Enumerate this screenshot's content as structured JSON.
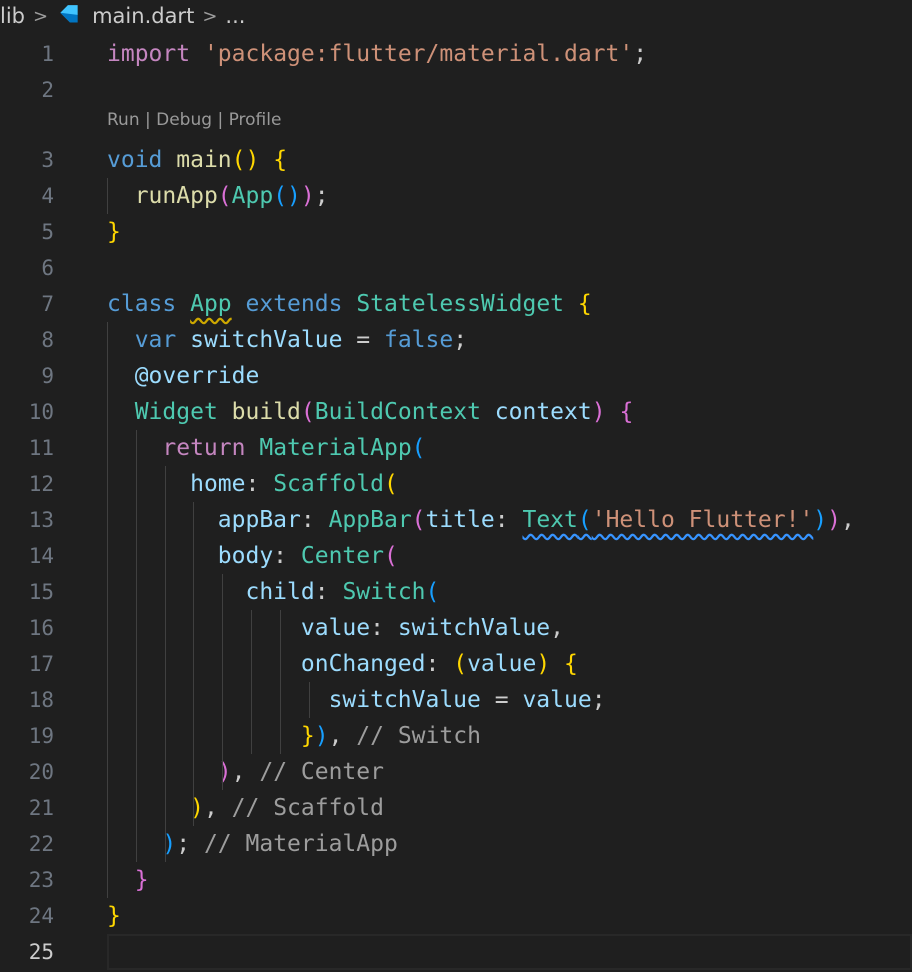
{
  "breadcrumb": {
    "folder": "lib",
    "file": "main.dart",
    "more": "..."
  },
  "codelens": "Run | Debug | Profile",
  "active_line": 25,
  "lines": [
    {
      "n": "1",
      "tokens": [
        {
          "t": "import",
          "c": "kw2"
        },
        {
          "t": " "
        },
        {
          "t": "'package:flutter/material.dart'",
          "c": "str"
        },
        {
          "t": ";",
          "c": "pun"
        }
      ]
    },
    {
      "n": "2",
      "tokens": []
    },
    {
      "n": "3",
      "tokens": [
        {
          "t": "void",
          "c": "kw"
        },
        {
          "t": " "
        },
        {
          "t": "main",
          "c": "fn"
        },
        {
          "t": "()",
          "c": "p1"
        },
        {
          "t": " "
        },
        {
          "t": "{",
          "c": "p1"
        }
      ]
    },
    {
      "n": "4",
      "tokens": [
        {
          "t": "  "
        },
        {
          "t": "runApp",
          "c": "fn"
        },
        {
          "t": "(",
          "c": "p2"
        },
        {
          "t": "App",
          "c": "typ"
        },
        {
          "t": "()",
          "c": "p3"
        },
        {
          "t": ")",
          "c": "p2"
        },
        {
          "t": ";",
          "c": "pun"
        }
      ]
    },
    {
      "n": "5",
      "tokens": [
        {
          "t": "}",
          "c": "p1"
        }
      ]
    },
    {
      "n": "6",
      "tokens": []
    },
    {
      "n": "7",
      "tokens": [
        {
          "t": "class",
          "c": "kw"
        },
        {
          "t": " "
        },
        {
          "t": "App",
          "c": "typ squig"
        },
        {
          "t": " "
        },
        {
          "t": "extends",
          "c": "kw"
        },
        {
          "t": " "
        },
        {
          "t": "StatelessWidget",
          "c": "typ"
        },
        {
          "t": " "
        },
        {
          "t": "{",
          "c": "p1"
        }
      ]
    },
    {
      "n": "8",
      "tokens": [
        {
          "t": "  "
        },
        {
          "t": "var",
          "c": "kw"
        },
        {
          "t": " "
        },
        {
          "t": "switchValue",
          "c": "var"
        },
        {
          "t": " = ",
          "c": "pun"
        },
        {
          "t": "false",
          "c": "num"
        },
        {
          "t": ";",
          "c": "pun"
        }
      ]
    },
    {
      "n": "9",
      "tokens": [
        {
          "t": "  "
        },
        {
          "t": "@override",
          "c": "var"
        }
      ]
    },
    {
      "n": "10",
      "tokens": [
        {
          "t": "  "
        },
        {
          "t": "Widget",
          "c": "typ"
        },
        {
          "t": " "
        },
        {
          "t": "build",
          "c": "fn"
        },
        {
          "t": "(",
          "c": "p2"
        },
        {
          "t": "BuildContext",
          "c": "typ"
        },
        {
          "t": " "
        },
        {
          "t": "context",
          "c": "var"
        },
        {
          "t": ")",
          "c": "p2"
        },
        {
          "t": " "
        },
        {
          "t": "{",
          "c": "p2"
        }
      ]
    },
    {
      "n": "11",
      "tokens": [
        {
          "t": "    "
        },
        {
          "t": "return",
          "c": "kw2"
        },
        {
          "t": " "
        },
        {
          "t": "MaterialApp",
          "c": "typ"
        },
        {
          "t": "(",
          "c": "p3"
        }
      ]
    },
    {
      "n": "12",
      "tokens": [
        {
          "t": "      "
        },
        {
          "t": "home",
          "c": "var"
        },
        {
          "t": ": ",
          "c": "pun"
        },
        {
          "t": "Scaffold",
          "c": "typ"
        },
        {
          "t": "(",
          "c": "p1"
        }
      ]
    },
    {
      "n": "13",
      "tokens": [
        {
          "t": "        "
        },
        {
          "t": "appBar",
          "c": "var"
        },
        {
          "t": ": ",
          "c": "pun"
        },
        {
          "t": "AppBar",
          "c": "typ"
        },
        {
          "t": "(",
          "c": "p2"
        },
        {
          "t": "title",
          "c": "var"
        },
        {
          "t": ": ",
          "c": "pun"
        },
        {
          "t": "Text",
          "c": "typ squig-b"
        },
        {
          "t": "(",
          "c": "p3 squig-b"
        },
        {
          "t": "'Hello Flutter!'",
          "c": "str squig-b"
        },
        {
          "t": ")",
          "c": "p3"
        },
        {
          "t": ")",
          "c": "p2"
        },
        {
          "t": ",",
          "c": "pun"
        }
      ]
    },
    {
      "n": "14",
      "tokens": [
        {
          "t": "        "
        },
        {
          "t": "body",
          "c": "var"
        },
        {
          "t": ": ",
          "c": "pun"
        },
        {
          "t": "Center",
          "c": "typ"
        },
        {
          "t": "(",
          "c": "p2"
        }
      ]
    },
    {
      "n": "15",
      "tokens": [
        {
          "t": "          "
        },
        {
          "t": "child",
          "c": "var"
        },
        {
          "t": ": ",
          "c": "pun"
        },
        {
          "t": "Switch",
          "c": "typ"
        },
        {
          "t": "(",
          "c": "p3"
        }
      ]
    },
    {
      "n": "16",
      "tokens": [
        {
          "t": "              "
        },
        {
          "t": "value",
          "c": "var"
        },
        {
          "t": ": ",
          "c": "pun"
        },
        {
          "t": "switchValue",
          "c": "var"
        },
        {
          "t": ",",
          "c": "pun"
        }
      ]
    },
    {
      "n": "17",
      "tokens": [
        {
          "t": "              "
        },
        {
          "t": "onChanged",
          "c": "var"
        },
        {
          "t": ": ",
          "c": "pun"
        },
        {
          "t": "(",
          "c": "p1"
        },
        {
          "t": "value",
          "c": "var"
        },
        {
          "t": ")",
          "c": "p1"
        },
        {
          "t": " "
        },
        {
          "t": "{",
          "c": "p1"
        }
      ]
    },
    {
      "n": "18",
      "tokens": [
        {
          "t": "                "
        },
        {
          "t": "switchValue",
          "c": "var"
        },
        {
          "t": " = ",
          "c": "pun"
        },
        {
          "t": "value",
          "c": "var"
        },
        {
          "t": ";",
          "c": "pun"
        }
      ]
    },
    {
      "n": "19",
      "tokens": [
        {
          "t": "              "
        },
        {
          "t": "}",
          "c": "p1"
        },
        {
          "t": ")",
          "c": "p3"
        },
        {
          "t": ", ",
          "c": "pun"
        },
        {
          "t": "// Switch",
          "c": "cmt"
        }
      ]
    },
    {
      "n": "20",
      "tokens": [
        {
          "t": "        "
        },
        {
          "t": ")",
          "c": "p2"
        },
        {
          "t": ", ",
          "c": "pun"
        },
        {
          "t": "// Center",
          "c": "cmt"
        }
      ]
    },
    {
      "n": "21",
      "tokens": [
        {
          "t": "      "
        },
        {
          "t": ")",
          "c": "p1"
        },
        {
          "t": ", ",
          "c": "pun"
        },
        {
          "t": "// Scaffold",
          "c": "cmt"
        }
      ]
    },
    {
      "n": "22",
      "tokens": [
        {
          "t": "    "
        },
        {
          "t": ")",
          "c": "p3"
        },
        {
          "t": "; ",
          "c": "pun"
        },
        {
          "t": "// MaterialApp",
          "c": "cmt"
        }
      ]
    },
    {
      "n": "23",
      "tokens": [
        {
          "t": "  "
        },
        {
          "t": "}",
          "c": "p2"
        }
      ]
    },
    {
      "n": "24",
      "tokens": [
        {
          "t": "}",
          "c": "p1"
        }
      ]
    },
    {
      "n": "25",
      "tokens": []
    }
  ]
}
